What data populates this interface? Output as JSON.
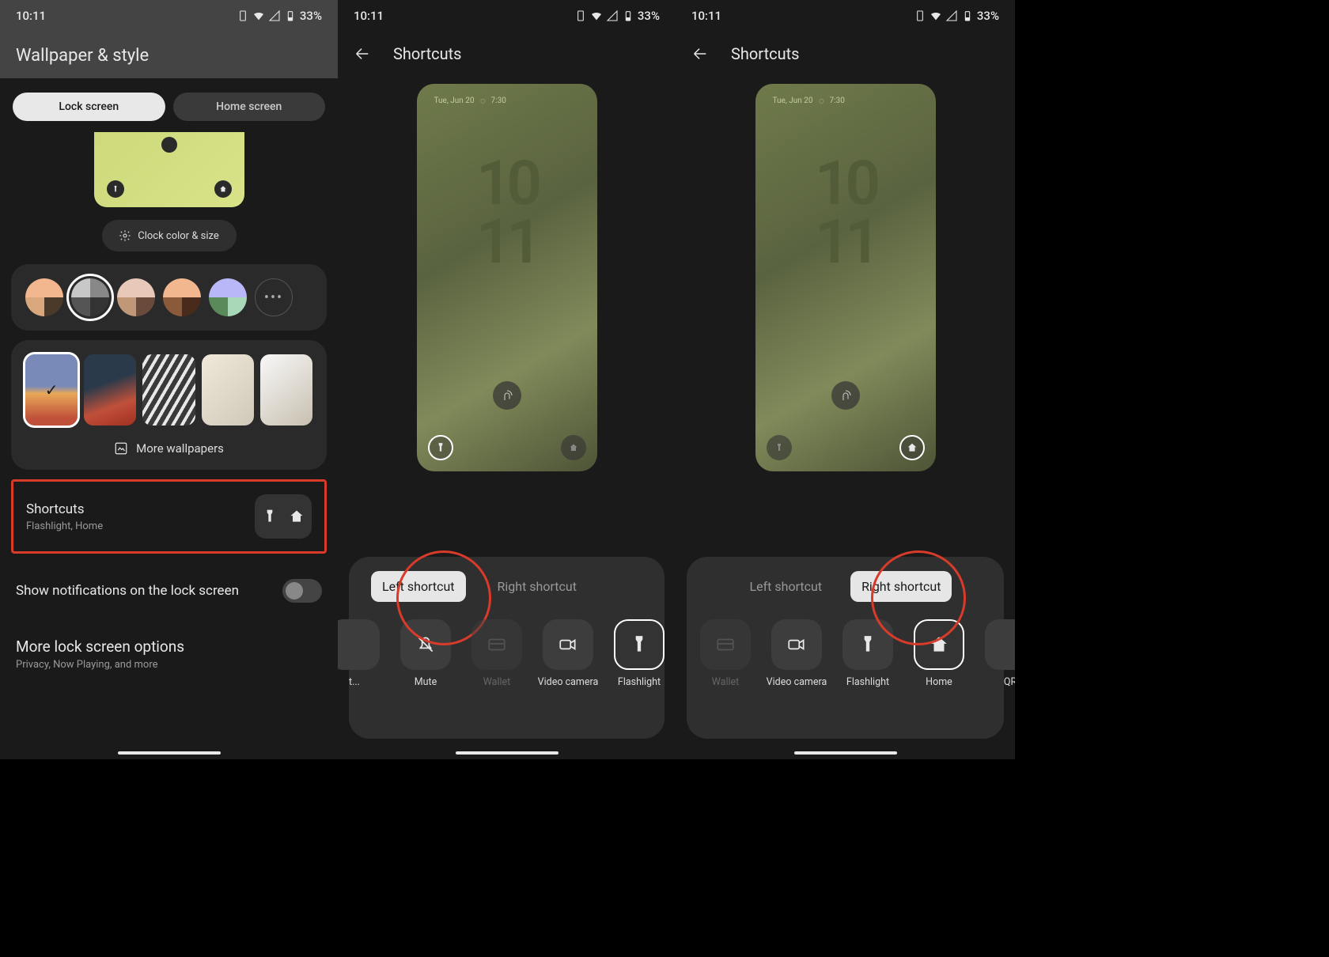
{
  "status": {
    "time": "10:11",
    "battery": "33%"
  },
  "screens": {
    "s1": {
      "title": "Wallpaper & style",
      "tabs": {
        "lock": "Lock screen",
        "home": "Home screen"
      },
      "clock_btn": "Clock color & size",
      "more_wallpapers": "More wallpapers",
      "shortcuts": {
        "title": "Shortcuts",
        "subtitle": "Flashlight, Home"
      },
      "notifications": "Show notifications on the lock screen",
      "more_options": {
        "title": "More lock screen options",
        "subtitle": "Privacy, Now Playing, and more"
      },
      "color_swatches": [
        {
          "tl": "#f3b78f",
          "tr": "#f3b78f",
          "bl": "#d9a77b",
          "br": "#4a3a2a"
        },
        {
          "tl": "#c8c8c8",
          "tr": "#888",
          "bl": "#555",
          "br": "#333"
        },
        {
          "tl": "#e8c8b8",
          "tr": "#e8c8b8",
          "bl": "#c09878",
          "br": "#6a4a3a"
        },
        {
          "tl": "#f3b78f",
          "tr": "#f3b78f",
          "bl": "#8a5a3a",
          "br": "#4a2a1a"
        },
        {
          "tl": "#b8b8f8",
          "tr": "#b8b8f8",
          "bl": "#5a8a5a",
          "br": "#a8d8b8"
        }
      ]
    },
    "s2": {
      "title": "Shortcuts",
      "preview_date": "Tue, Jun 20",
      "preview_time": "7:30",
      "clock_top": "10",
      "clock_bottom": "11",
      "tabs": {
        "left": "Left shortcut",
        "right": "Right shortcut"
      },
      "options": [
        {
          "label": "t...",
          "icon": "unknown",
          "partial": "left"
        },
        {
          "label": "Mute",
          "icon": "mute"
        },
        {
          "label": "Wallet",
          "icon": "wallet",
          "disabled": true
        },
        {
          "label": "Video camera",
          "icon": "video"
        },
        {
          "label": "Flashlight",
          "icon": "flashlight",
          "selected": true
        }
      ]
    },
    "s3": {
      "title": "Shortcuts",
      "preview_date": "Tue, Jun 20",
      "preview_time": "7:30",
      "clock_top": "10",
      "clock_bottom": "11",
      "tabs": {
        "left": "Left shortcut",
        "right": "Right shortcut"
      },
      "options": [
        {
          "label": "Wallet",
          "icon": "wallet",
          "disabled": true
        },
        {
          "label": "Video camera",
          "icon": "video"
        },
        {
          "label": "Flashlight",
          "icon": "flashlight"
        },
        {
          "label": "Home",
          "icon": "home",
          "selected": true
        },
        {
          "label": "QR",
          "icon": "qr",
          "partial": "right"
        }
      ]
    }
  }
}
